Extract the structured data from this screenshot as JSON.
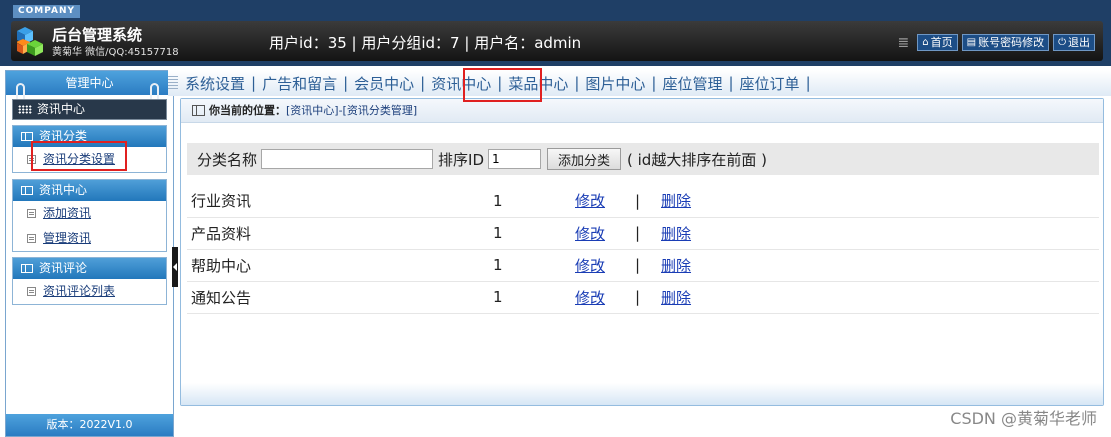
{
  "header": {
    "company": "COMPANY",
    "title": "后台管理系统",
    "author": "黄菊华 微信/QQ:45157718",
    "user_info": "用户id：35 | 用户分组id：7 | 用户名：admin",
    "links": [
      {
        "icon": "home-icon",
        "label": "首页"
      },
      {
        "icon": "account-icon",
        "label": "账号密码修改"
      },
      {
        "icon": "power-icon",
        "label": "退出"
      }
    ]
  },
  "sidebar": {
    "title": "管理中心",
    "current_section": "资讯中心",
    "groups": [
      {
        "title": "资讯分类",
        "items": [
          "资讯分类设置"
        ]
      },
      {
        "title": "资讯中心",
        "items": [
          "添加资讯",
          "管理资讯"
        ]
      },
      {
        "title": "资讯评论",
        "items": [
          "资讯评论列表"
        ]
      }
    ],
    "footer": "版本：2022V1.0"
  },
  "nav": {
    "items": [
      "系统设置",
      "广告和留言",
      "会员中心",
      "资讯中心",
      "菜品中心",
      "图片中心",
      "座位管理",
      "座位订单"
    ],
    "separator": "|"
  },
  "breadcrumb": {
    "label": "你当前的位置：",
    "trail": "[资讯中心]-[资讯分类管理]"
  },
  "add_form": {
    "name_label": "分类名称",
    "name_value": "",
    "sort_label": "排序ID",
    "sort_value": "1",
    "button": "添加分类",
    "hint": "( id越大排序在前面 )"
  },
  "table": {
    "edit_label": "修改",
    "delete_label": "删除",
    "separator": "|",
    "rows": [
      {
        "name": "行业资讯",
        "sort": "1"
      },
      {
        "name": "产品资料",
        "sort": "1"
      },
      {
        "name": "帮助中心",
        "sort": "1"
      },
      {
        "name": "通知公告",
        "sort": "1"
      }
    ]
  },
  "watermark": "CSDN @黄菊华老师",
  "colors": {
    "header_bg": "#1f3f66",
    "accent_blue": "#2b7cc2",
    "link_blue": "#1a3db5",
    "highlight_red": "#e02020"
  }
}
